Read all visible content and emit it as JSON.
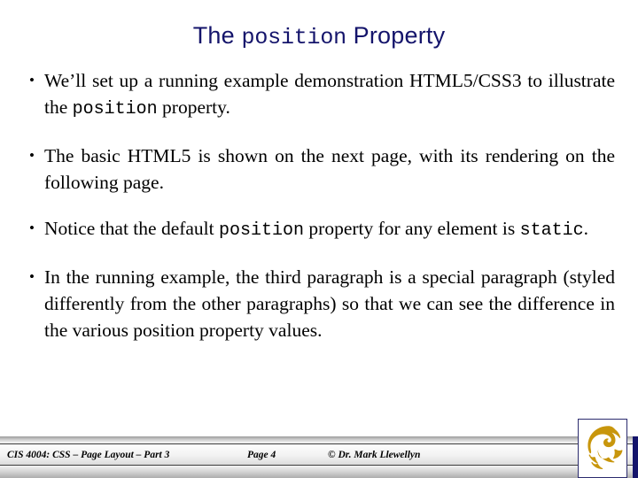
{
  "slide": {
    "title": {
      "part1": "The ",
      "mono": "position",
      "part2": " Property"
    },
    "bullets": [
      {
        "marker": "•",
        "segments": [
          {
            "text": "We’ll set up a running example demonstration HTML5/CSS3 to illustrate the ",
            "mono": false
          },
          {
            "text": "position",
            "mono": true
          },
          {
            "text": " property.",
            "mono": false
          }
        ]
      },
      {
        "marker": "•",
        "segments": [
          {
            "text": "The basic HTML5 is shown on the next page, with its rendering on the following page.",
            "mono": false
          }
        ]
      },
      {
        "marker": "•",
        "segments": [
          {
            "text": "Notice that the default ",
            "mono": false
          },
          {
            "text": "position",
            "mono": true
          },
          {
            "text": " property for any element is ",
            "mono": false
          },
          {
            "text": "static",
            "mono": true
          },
          {
            "text": ".",
            "mono": false
          }
        ]
      },
      {
        "marker": "•",
        "segments": [
          {
            "text": "In the running example, the third paragraph is a special paragraph (styled differently from the other paragraphs) so that we can see the difference in the various position property values.",
            "mono": false
          }
        ]
      }
    ]
  },
  "footer": {
    "course": "CIS 4004: CSS – Page Layout – Part 3",
    "page": "Page 4",
    "copyright": "© Dr. Mark Llewellyn",
    "logo_name": "ucf-pegasus-logo"
  },
  "colors": {
    "title": "#14146b",
    "body_text": "#000000",
    "logo_gold": "#c8960c",
    "logo_border": "#2b2b6e",
    "footer_edge": "#14146b"
  }
}
